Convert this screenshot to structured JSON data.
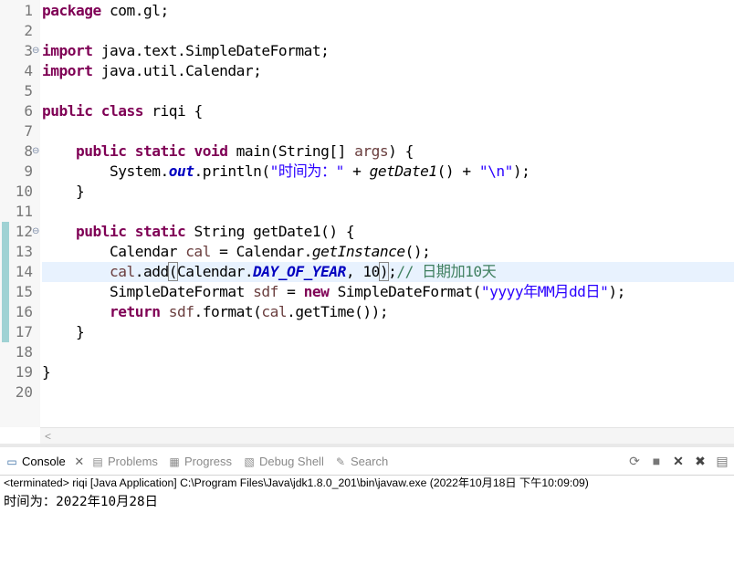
{
  "editor": {
    "line_numbers": [
      "1",
      "2",
      "3",
      "4",
      "5",
      "6",
      "7",
      "8",
      "9",
      "10",
      "11",
      "12",
      "13",
      "14",
      "15",
      "16",
      "17",
      "18",
      "19",
      "20"
    ],
    "lines": {
      "l1": {
        "kw": "package",
        "rest": " com.gl;"
      },
      "l3": {
        "kw": "import",
        "rest": " java.text.SimpleDateFormat;"
      },
      "l4": {
        "kw": "import",
        "rest": " java.util.Calendar;"
      },
      "l6": {
        "kw1": "public",
        "kw2": "class",
        "rest": " riqi {"
      },
      "l8": {
        "kw1": "public",
        "kw2": "static",
        "kw3": "void",
        "a": " main(String[] ",
        "var": "args",
        "b": ") {"
      },
      "l9": {
        "a": "System.",
        "fld": "out",
        "b": ".println(",
        "str1": "\"时间为：\"",
        "c": " + ",
        "call": "getDate1",
        "d": "() + ",
        "str2": "\"\\n\"",
        "e": ");"
      },
      "l10": {
        "text": "}"
      },
      "l12": {
        "kw1": "public",
        "kw2": "static",
        "rest": " String getDate1() {"
      },
      "l13": {
        "a": "Calendar ",
        "var": "cal",
        "b": " = Calendar.",
        "call": "getInstance",
        "c": "();"
      },
      "l14": {
        "var": "cal",
        "a": ".add",
        "p": "(",
        "b": "Calendar.",
        "fld": "DAY_OF_YEAR",
        "c": ", 10",
        "p2": ")",
        "d": ";",
        "cmt": "// 日期加10天"
      },
      "l15": {
        "a": "SimpleDateFormat ",
        "var": "sdf",
        "b": " = ",
        "kw": "new",
        "c": " SimpleDateFormat(",
        "str": "\"yyyy年MM月dd日\"",
        "d": ");"
      },
      "l16": {
        "kw": "return",
        "var1": "sdf",
        "a": ".format(",
        "var2": "cal",
        "b": ".getTime());"
      },
      "l17": {
        "text": "}"
      },
      "l19": {
        "text": "}"
      }
    }
  },
  "console": {
    "tabs": [
      {
        "label": "Console",
        "icon": "console-icon",
        "active": true
      },
      {
        "label": "Problems",
        "icon": "problems-icon"
      },
      {
        "label": "Progress",
        "icon": "progress-icon"
      },
      {
        "label": "Debug Shell",
        "icon": "debug-shell-icon"
      },
      {
        "label": "Search",
        "icon": "search-icon"
      }
    ],
    "status": "<terminated> riqi [Java Application] C:\\Program Files\\Java\\jdk1.8.0_201\\bin\\javaw.exe (2022年10月18日 下午10:09:09)",
    "output": "时间为：2022年10月28日"
  },
  "colors": {
    "keyword": "#7f0055",
    "field": "#0000c0",
    "string": "#2a00ff",
    "comment": "#3f7f5f",
    "variable": "#6a3e3e"
  }
}
